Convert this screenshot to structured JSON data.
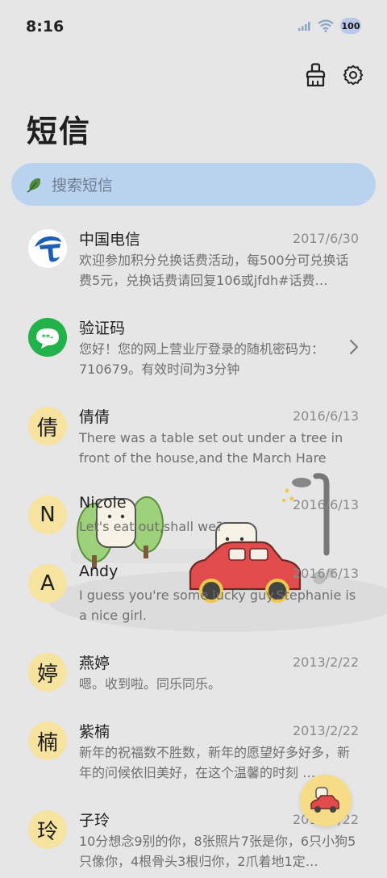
{
  "status": {
    "time": "8:16",
    "battery": "100"
  },
  "header": {
    "title": "短信"
  },
  "search": {
    "placeholder": "搜索短信"
  },
  "messages": [
    {
      "avatar": "",
      "name": "中国电信",
      "date": "2017/6/30",
      "preview": "欢迎参加积分兑换话费活动，每500分可兑换话费5元，兑换话费请回复106或jfdh#话费…"
    },
    {
      "avatar": "",
      "name": "验证码",
      "date": "",
      "preview": "您好！您的网上营业厅登录的随机密码为：710679。有效时间为3分钟"
    },
    {
      "avatar": "倩",
      "name": "倩倩",
      "date": "2016/6/13",
      "preview": "There was a table set out under a tree in front of the house,and the March Hare an…"
    },
    {
      "avatar": "N",
      "name": "Nicole",
      "date": "2016/6/13",
      "preview": "Let's eat out,shall we?"
    },
    {
      "avatar": "A",
      "name": "Andy",
      "date": "2016/6/13",
      "preview": "I guess you're some lucky guy.Stephanie is a nice girl."
    },
    {
      "avatar": "婷",
      "name": "燕婷",
      "date": "2013/2/22",
      "preview": "嗯。收到啦。同乐同乐。"
    },
    {
      "avatar": "楠",
      "name": "紫楠",
      "date": "2013/2/22",
      "preview": "新年的祝福数不胜数，新年的愿望好多好多，新年的问候依旧美好，在这个温馨的时刻 …"
    },
    {
      "avatar": "玲",
      "name": "子玲",
      "date": "2013/2/22",
      "preview": "10分想念9别的你，8张照片7张是你，6只小狗5只像你，4根骨头3根归你，2爪着地1定…"
    }
  ],
  "colors": {
    "accent_search": "#b9d3ef",
    "avatar_bg": "#f7e3a0",
    "telecom_blue": "#1a5fb4",
    "sms_green": "#21b24a"
  }
}
